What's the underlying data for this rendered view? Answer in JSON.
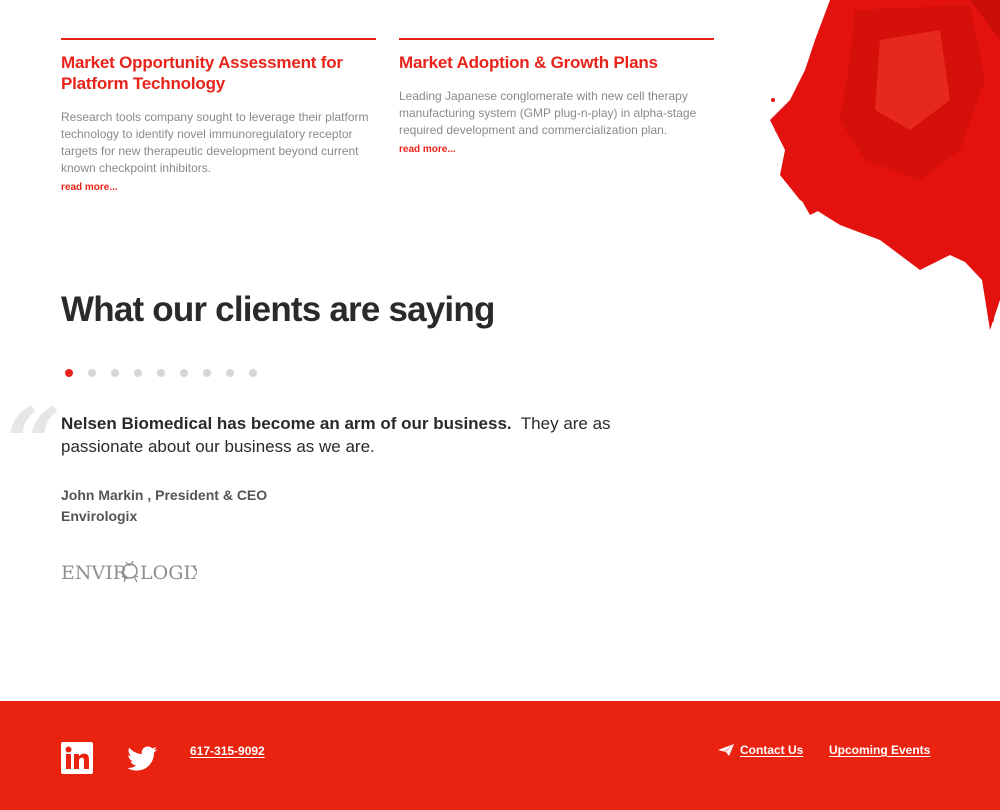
{
  "cards": [
    {
      "title": "Market Opportunity Assessment for Platform Technology",
      "description": "Research tools company sought to leverage their platform technology to identify novel immunoregulatory receptor targets for new therapeutic development beyond current known checkpoint inhibitors.",
      "link": "read more..."
    },
    {
      "title": "Market Adoption & Growth Plans",
      "description": "Leading Japanese conglomerate with new cell therapy manufacturing system (GMP plug-n-play) in alpha-stage required development and commercialization plan.",
      "link": "read more..."
    }
  ],
  "testimonials": {
    "heading": "What our clients are saying",
    "slide_count": 9,
    "active_slide": 1,
    "quote_mark": "“",
    "quote_bold": "Nelsen Biomedical has become an arm of our business.",
    "quote_rest": "They are as passionate about our business as we are.",
    "author": "John Markin , President & CEO",
    "company": "Envirologix",
    "logo_text_left": "ENVIR",
    "logo_text_right": "LOGIX"
  },
  "footer": {
    "linkedin_icon": "linkedin-icon",
    "twitter_icon": "twitter-icon",
    "phone": "617-315-9092",
    "contact_label": "Contact Us",
    "events_label": "Upcoming Events"
  },
  "colors": {
    "accent": "#e8231a",
    "footer_bg": "#ea2310"
  }
}
